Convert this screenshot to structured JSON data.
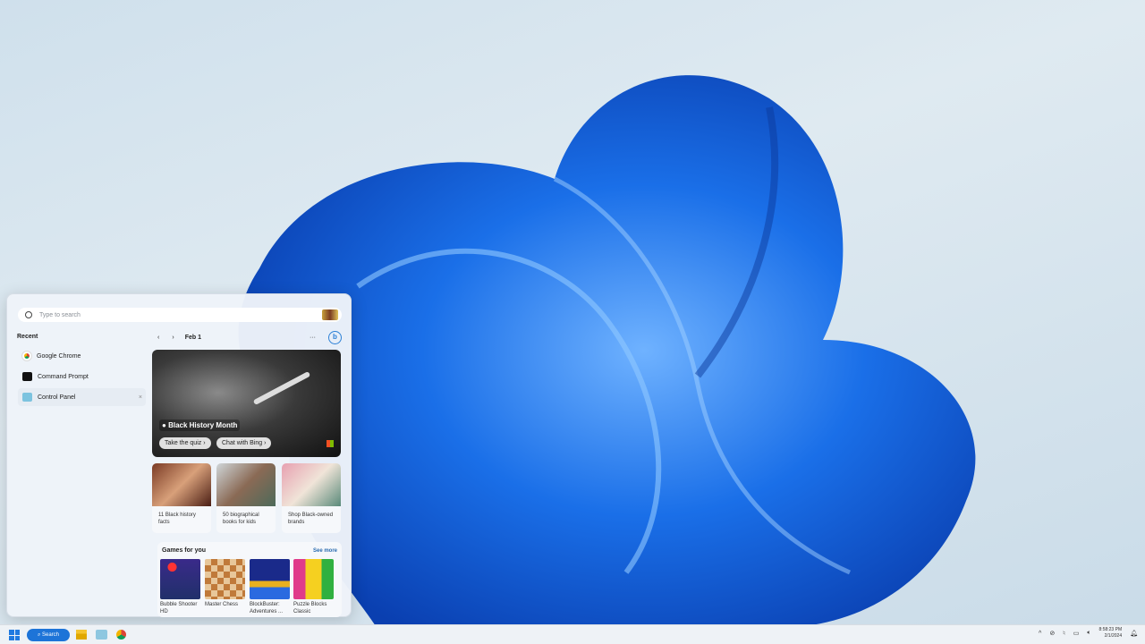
{
  "search": {
    "placeholder": "Type to search"
  },
  "recent": {
    "heading": "Recent",
    "items": [
      {
        "label": "Google Chrome"
      },
      {
        "label": "Command Prompt"
      },
      {
        "label": "Control Panel"
      }
    ],
    "remove": "×"
  },
  "feed": {
    "date": "Feb 1",
    "prev": "‹",
    "next": "›",
    "more": "···",
    "bing": "b",
    "hero": {
      "title": "Black History Month",
      "quiz": "Take the quiz ›",
      "chat": "Chat with Bing ›"
    },
    "cards": [
      {
        "caption": "11 Black history facts"
      },
      {
        "caption": "50 biographical books for kids"
      },
      {
        "caption": "Shop Black-owned brands"
      }
    ],
    "games": {
      "heading": "Games for you",
      "see_more": "See more",
      "items": [
        {
          "label": "Bubble Shooter HD"
        },
        {
          "label": "Master Chess"
        },
        {
          "label": "BlockBuster: Adventures ..."
        },
        {
          "label": "Puzzle Blocks Classic"
        }
      ]
    }
  },
  "taskbar": {
    "search_label": "Search",
    "time": "8:58:23 PM",
    "date": "2/1/2024"
  },
  "colors": {
    "accent": "#1d74d8",
    "wallpaper": "#1a6fe8"
  }
}
